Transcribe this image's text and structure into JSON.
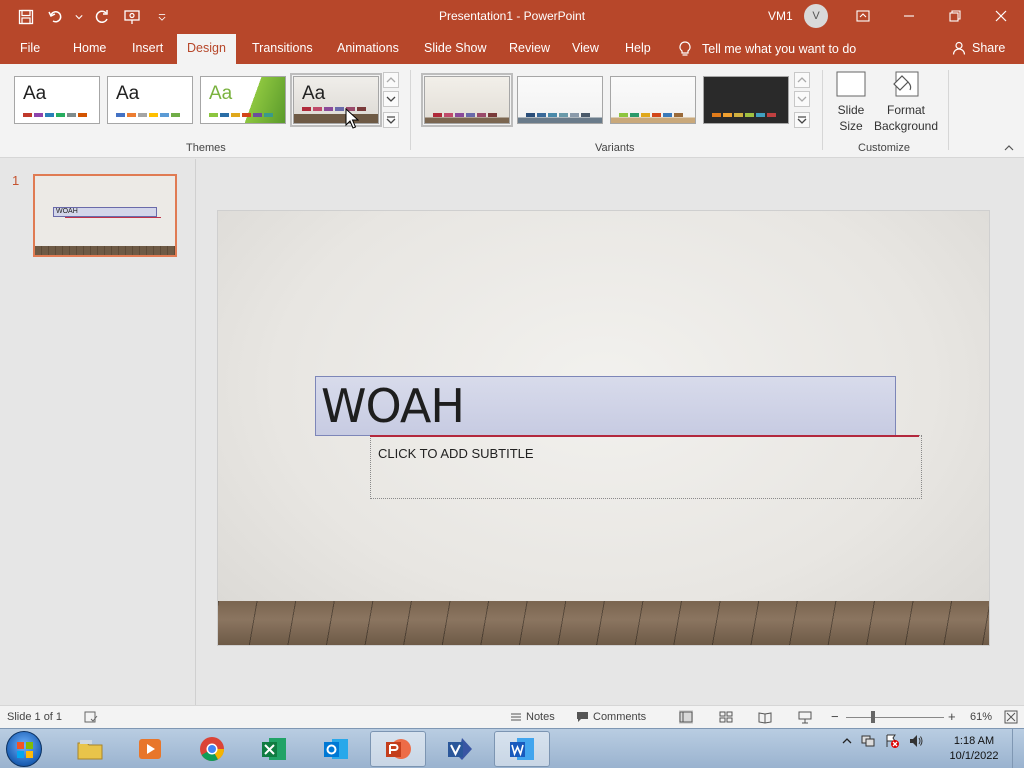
{
  "app": {
    "doc_title": "Presentation1 - PowerPoint",
    "user_name": "VM1",
    "user_initial": "V"
  },
  "menu": {
    "tabs": [
      "File",
      "Home",
      "Insert",
      "Design",
      "Transitions",
      "Animations",
      "Slide Show",
      "Review",
      "View",
      "Help"
    ],
    "active_tab": "Design",
    "tell_me": "Tell me what you want to do",
    "share": "Share"
  },
  "ribbon": {
    "groups": {
      "themes": "Themes",
      "variants": "Variants",
      "customize": "Customize"
    },
    "theme_glyph": "Aa",
    "slide_size_label_1": "Slide",
    "slide_size_label_2": "Size",
    "format_bg_label_1": "Format",
    "format_bg_label_2": "Background"
  },
  "colors": {
    "accent": "#b7472a",
    "thumb_border": "#e07b53",
    "title_fill": "#c7cbe2"
  },
  "thumbnails": {
    "number": "1",
    "title_text": "WOAH"
  },
  "slide": {
    "title": "WOAH",
    "subtitle_placeholder": "CLICK TO ADD SUBTITLE"
  },
  "status": {
    "slide_info": "Slide 1 of 1",
    "notes": "Notes",
    "comments": "Comments",
    "zoom_minus": "−",
    "zoom_plus": "+",
    "zoom": "61%"
  },
  "taskbar": {
    "time": "1:18 AM",
    "date": "10/1/2022"
  }
}
